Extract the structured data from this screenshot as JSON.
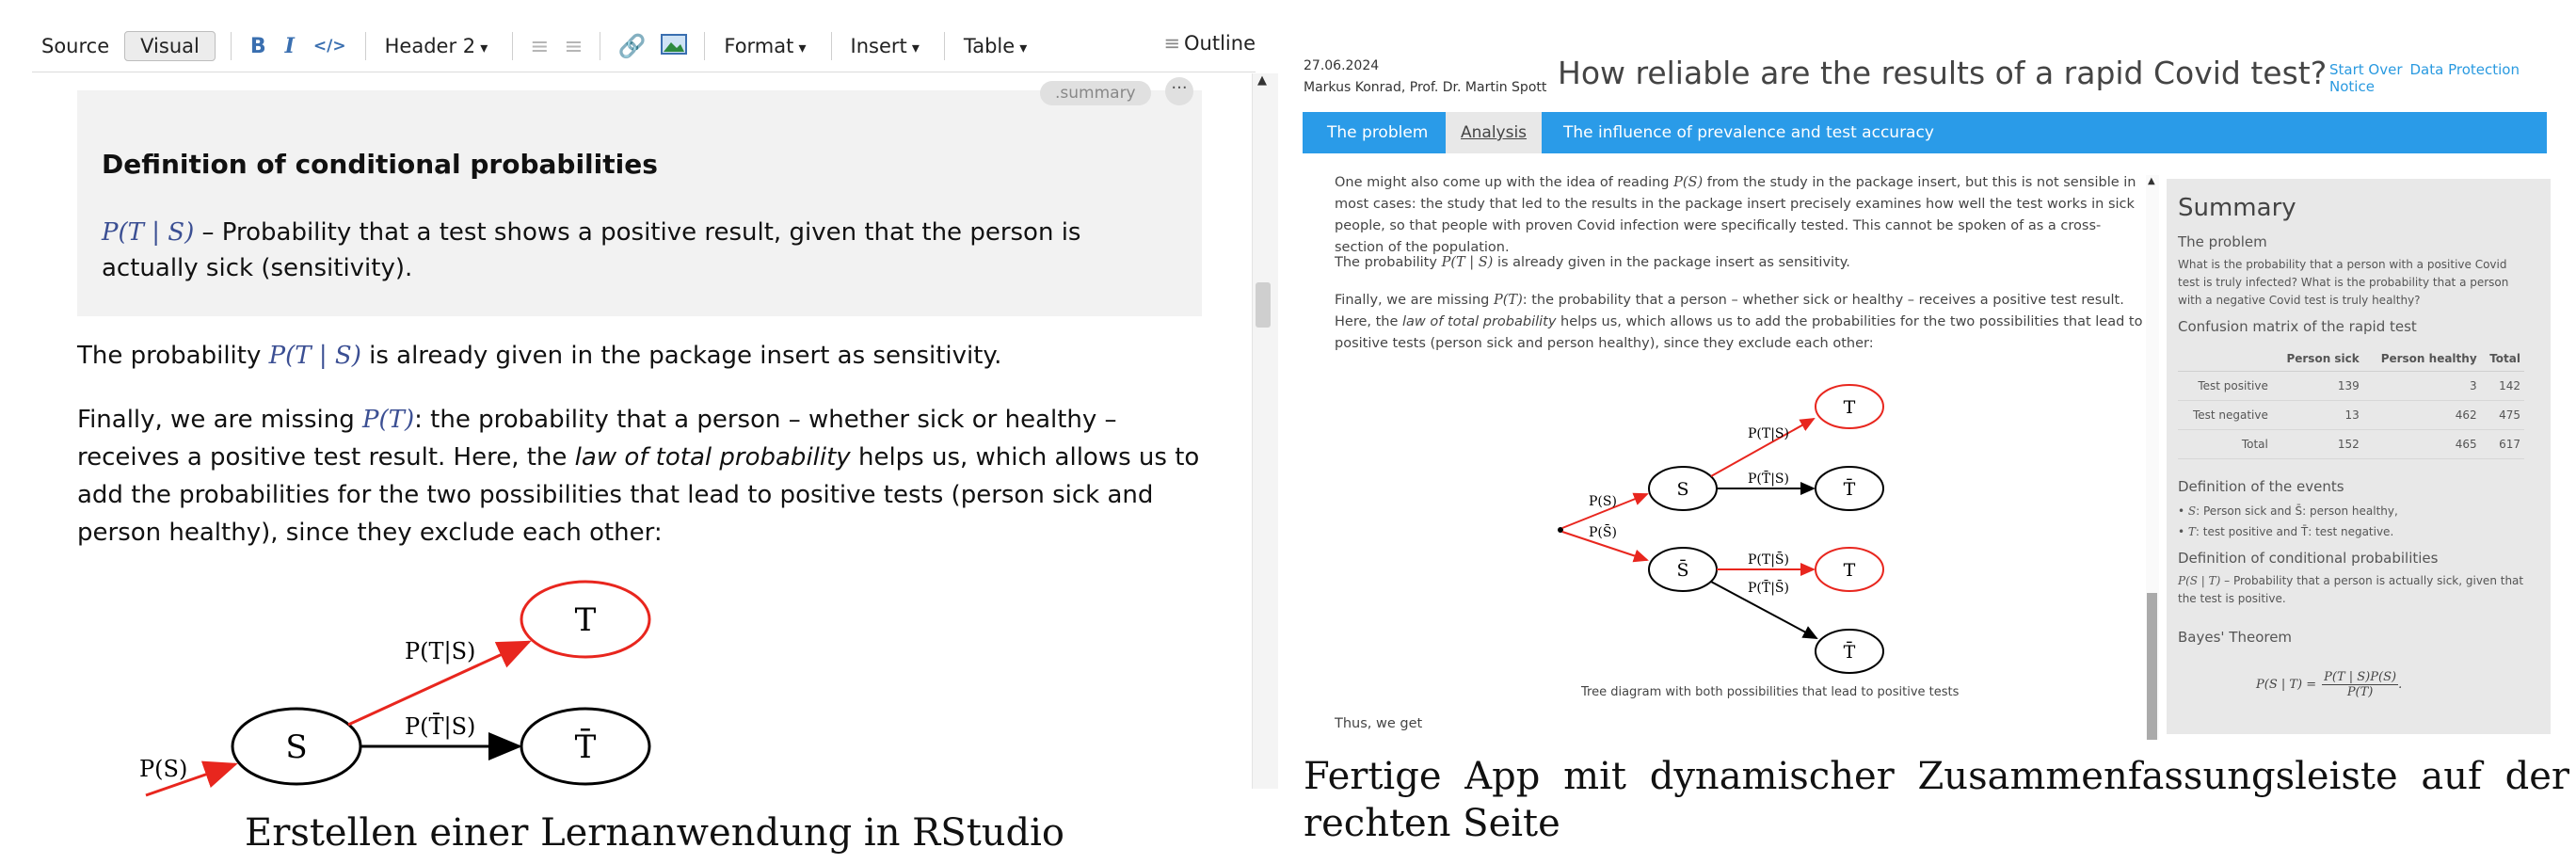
{
  "left": {
    "toolbar": {
      "source": "Source",
      "visual": "Visual",
      "bold": "B",
      "italic": "I",
      "code": "</>",
      "header": "Header 2",
      "format": "Format",
      "insert": "Insert",
      "table": "Table",
      "outline": "Outline"
    },
    "callout": {
      "tag": ".summary",
      "menu": "···",
      "heading": "Definition of conditional probabilities",
      "math": "P(T | S)",
      "text": " – Probability that a test shows a positive result, given that the person is actually sick (sensitivity)."
    },
    "para1": {
      "pre": "The probability ",
      "math": "P(T | S)",
      "post": " is already given in the package insert as sensitivity."
    },
    "para2": {
      "pre": "Finally, we are missing ",
      "math": "P(T)",
      "mid": ": the probability that a person – whether sick or healthy – receives a positive test result. Here, the ",
      "em": "law of total probability",
      "post": " helps us, which allows us to add the probabilities for the two possibilities that lead to positive tests (person sick and person healthy), since they exclude each other:"
    },
    "diagram": {
      "node_s": "S",
      "node_t": "T",
      "node_tbar": "T̄",
      "edge_ts": "P(T|S)",
      "edge_tbar_s": "P(T̄|S)",
      "edge_s": "P(S)"
    },
    "caption": "Erstellen einer Lernanwendung in RStudio"
  },
  "right": {
    "date": "27.06.2024",
    "authors": "Markus Konrad, Prof. Dr. Martin Spott",
    "title": "How reliable are the results of a rapid Covid test?",
    "links": [
      "Start Over",
      "Data Protection Notice"
    ],
    "tabs": [
      "The problem",
      "Analysis",
      "The influence of prevalence and test accuracy"
    ],
    "body": {
      "p0_pre": "One might also come up with the idea of reading ",
      "p0_math": "P(S)",
      "p0_post": " from the study in the package insert, but this is not sensible in most cases: the study that led to the results in the package insert precisely examines how well the test works in sick people, so that people with proven Covid infection were specifically tested. This cannot be spoken of as a cross-section of the population.",
      "p1_pre": "The probability ",
      "p1_math": "P(T | S)",
      "p1_post": " is already given in the package insert as sensitivity.",
      "p2_pre": "Finally, we are missing ",
      "p2_math": "P(T)",
      "p2_mid": ": the probability that a person – whether sick or healthy – receives a positive test result. Here, the ",
      "p2_em": "law of total probability",
      "p2_post": " helps us, which allows us to add the probabilities for the two possibilities that lead to positive tests (person sick and person healthy), since they exclude each other:",
      "thus": "Thus, we get"
    },
    "tree": {
      "S": "S",
      "Sbar": "S̄",
      "T1": "T",
      "T2": "T̄",
      "T3": "T",
      "T4": "T̄",
      "pS": "P(S)",
      "pSbar": "P(S̄)",
      "pT_S": "P(T|S)",
      "pTbar_S": "P(T̄|S)",
      "pT_Sbar": "P(T|S̄)",
      "pTbar_Sbar": "P(T̄|S̄)",
      "caption": "Tree diagram with both possibilities that lead to positive tests"
    },
    "summary": {
      "heading": "Summary",
      "problem_h": "The problem",
      "problem": "What is the probability that a person with a positive Covid test is truly infected? What is the probability that a person with a negative Covid test is truly healthy?",
      "matrix_h": "Confusion matrix of the rapid test",
      "columns": [
        "",
        "Person sick",
        "Person healthy",
        "Total"
      ],
      "rows": [
        [
          "Test positive",
          "139",
          "3",
          "142"
        ],
        [
          "Test negative",
          "13",
          "462",
          "475"
        ],
        [
          "Total",
          "152",
          "465",
          "617"
        ]
      ],
      "events_h": "Definition of the events",
      "event1": ": Person sick and S̄: person healthy,",
      "event2": ": test positive and T̄: test negative.",
      "cond_h": "Definition of conditional probabilities",
      "cond_math": "P(S | T)",
      "cond": " – Probability that a person is actually sick, given that the test is positive.",
      "bayes_h": "Bayes' Theorem",
      "bayes_lhs": "P(S | T) =",
      "bayes_num": "P(T | S)P(S)",
      "bayes_den": "P(T)"
    },
    "caption": "Fertige App mit dynamischer Zusammenfassungsleiste auf der rechten Seite"
  },
  "colors": {
    "accent_blue": "#2a9be8",
    "edge_red": "#e8261e",
    "math_blue": "#3b4f93"
  }
}
